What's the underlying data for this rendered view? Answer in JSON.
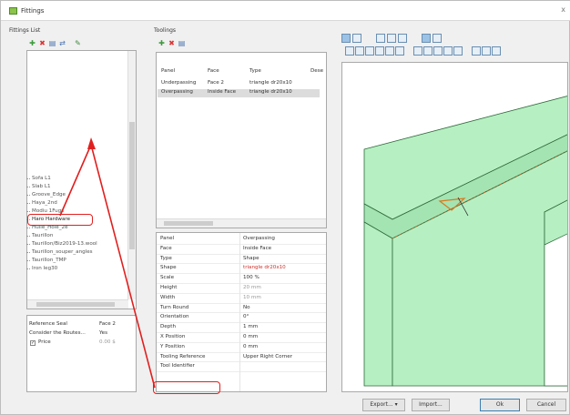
{
  "window": {
    "title": "Fittings",
    "close_glyph": "x"
  },
  "fittings_list": {
    "label": "Fittings List",
    "toolbar_icons": [
      "add-icon",
      "delete-icon",
      "edit-icon",
      "link-icon",
      "tool-icon"
    ],
    "items": [
      "Sofa L1",
      "Slab L1",
      "Groove_Edge",
      "Haya_2nd",
      "Modiu 1Fugs",
      "Haro Hardware",
      "Hulle_Hole_2e",
      "Taurillon",
      "Taurillon/Biz2019-13.wool",
      "Taurillon_souper_angles",
      "Taurillon_TMP",
      "Iron leg30"
    ],
    "highlighted_item": "Haro Hardware"
  },
  "ref_table": {
    "rows": [
      {
        "label": "Reference Seal",
        "value": "Face 2"
      },
      {
        "label": "Consider the Routes...",
        "value": "Yes"
      },
      {
        "label": "Price",
        "value": "0.00 $"
      }
    ]
  },
  "toolings": {
    "label": "Toolings",
    "toolbar_icons": [
      "add-icon",
      "delete-icon",
      "copy-icon"
    ],
    "columns": [
      "Panel",
      "Face",
      "Type",
      "Dese"
    ],
    "rows": [
      {
        "panel": "Underpassing",
        "face": "Face 2",
        "type": "triangle dr20x10"
      },
      {
        "panel": "Overpassing",
        "face": "Inside Face",
        "type": "triangle dr20x10"
      }
    ]
  },
  "properties": [
    {
      "label": "Panel",
      "value": "Overpassing"
    },
    {
      "label": "Face",
      "value": "Inside Face"
    },
    {
      "label": "Type",
      "value": "Shape"
    },
    {
      "label": "Shape",
      "value": "triangle dr20x10"
    },
    {
      "label": "Scale",
      "value": "100 %"
    },
    {
      "label": "Height",
      "value": "20 mm"
    },
    {
      "label": "Width",
      "value": "10 mm"
    },
    {
      "label": "Turn Round",
      "value": "No"
    },
    {
      "label": "Orientation",
      "value": "0°"
    },
    {
      "label": "Depth",
      "value": "1 mm"
    },
    {
      "label": "X Position",
      "value": "0 mm"
    },
    {
      "label": "Y Position",
      "value": "0 mm"
    },
    {
      "label": "Tooling Reference",
      "value": "Upper Right Corner"
    },
    {
      "label": "Tool Identifier",
      "value": ""
    }
  ],
  "viewport": {
    "toolbar_row1_icons": [
      "select-icon",
      "move-icon",
      "rotate-icon",
      "pan-icon",
      "zoom-icon",
      "render-icon",
      "wire-icon"
    ],
    "toolbar_row2_icons": [
      "view-top-icon",
      "view-bottom-icon",
      "view-left-icon",
      "view-right-icon",
      "view-front-icon",
      "view-back-icon",
      "iso-1-icon",
      "iso-2-icon",
      "iso-3-icon",
      "iso-4-icon",
      "iso-5-icon",
      "iso-6-icon",
      "iso-7-icon",
      "iso-8-icon"
    ],
    "panel_color": "#b6f0c2",
    "edge_color": "#2e6a3a",
    "tool_color": "#d87a20"
  },
  "buttons": {
    "export": "Export...",
    "import": "Import...",
    "ok": "Ok",
    "cancel": "Cancel",
    "dropdown_glyph": "▾"
  },
  "colors": {
    "annotation": "#e0201f",
    "selection": "#dcdcdc"
  }
}
